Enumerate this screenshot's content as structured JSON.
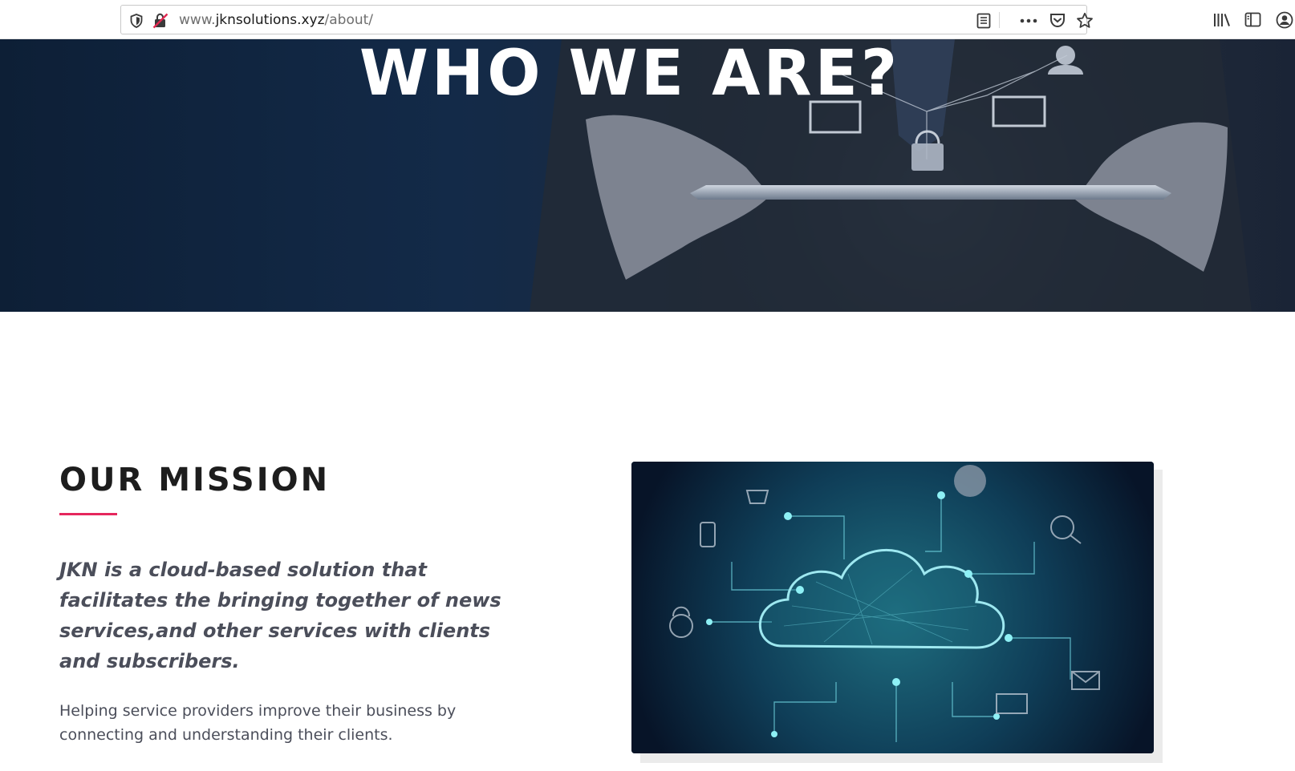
{
  "browser": {
    "url_prefix": "www.",
    "url_host": "jknsolutions.xyz",
    "url_path": "/about/",
    "icons": [
      "shield-icon",
      "insecure-lock-icon",
      "reader-view-icon",
      "more-actions-icon",
      "pocket-icon",
      "bookmark-star-icon",
      "library-icon",
      "sidebar-icon",
      "account-icon"
    ]
  },
  "hero": {
    "title": "WHO WE ARE?"
  },
  "mission": {
    "title": "OUR MISSION",
    "lead": "JKN is a cloud-based solution that facilitates the bringing together of news services,and other services with clients and subscribers.",
    "body": "Helping service providers improve their business by connecting and understanding their clients."
  },
  "colors": {
    "accent": "#e5275d",
    "hero_bg": "#132a48",
    "heading": "#1d1d1d",
    "text": "#4b4e5a"
  }
}
